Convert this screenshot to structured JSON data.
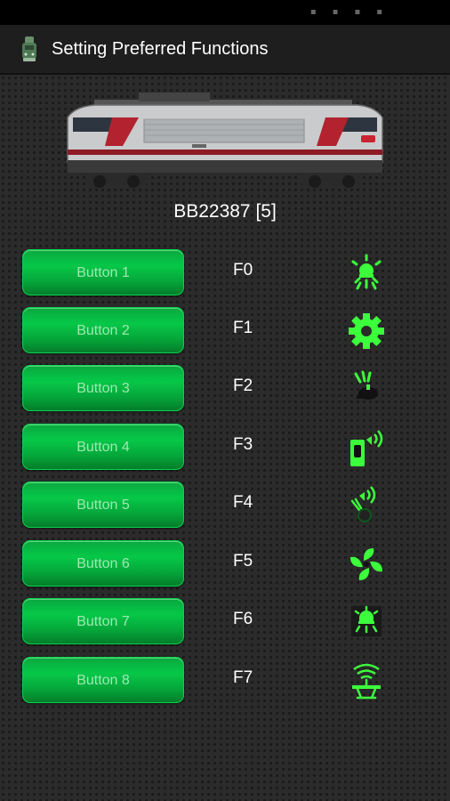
{
  "app_bar": {
    "title": "Setting Preferred Functions",
    "logo_icon": "locomotive-app-icon"
  },
  "loco": {
    "image": "electric-locomotive-photo",
    "name": "BB22387 [5]"
  },
  "functions": [
    {
      "button_label": "Button 1",
      "function": "F0",
      "icon": "headlight-icon"
    },
    {
      "button_label": "Button 2",
      "function": "F1",
      "icon": "gear-icon"
    },
    {
      "button_label": "Button 3",
      "function": "F2",
      "icon": "horn-icon"
    },
    {
      "button_label": "Button 4",
      "function": "F3",
      "icon": "sound-phone-icon"
    },
    {
      "button_label": "Button 5",
      "function": "F4",
      "icon": "sound-brake-icon"
    },
    {
      "button_label": "Button 6",
      "function": "F5",
      "icon": "fan-icon"
    },
    {
      "button_label": "Button 7",
      "function": "F6",
      "icon": "cab-light-icon"
    },
    {
      "button_label": "Button 8",
      "function": "F7",
      "icon": "pantograph-icon"
    }
  ],
  "colors": {
    "button_green": "#06c848",
    "icon_green": "#3cff3c",
    "background": "#2b2b2b"
  }
}
